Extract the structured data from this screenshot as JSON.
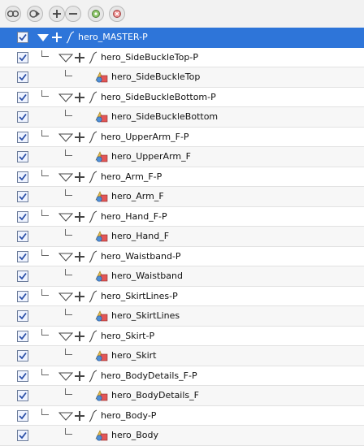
{
  "toolbar": {
    "buttons": [
      {
        "name": "show-all-icon"
      },
      {
        "name": "hide-all-icon"
      },
      {
        "name": "expand-icon"
      },
      {
        "name": "collapse-icon"
      },
      {
        "name": "layer-properties-icon"
      },
      {
        "name": "peg-icon"
      }
    ]
  },
  "layers": [
    {
      "label": "hero_MASTER-P",
      "type": "peg",
      "level": 0,
      "selected": true,
      "checked": true
    },
    {
      "label": "hero_SideBuckleTop-P",
      "type": "peg",
      "level": 1,
      "checked": true
    },
    {
      "label": "hero_SideBuckleTop",
      "type": "drawing",
      "level": 2,
      "checked": true
    },
    {
      "label": "hero_SideBuckleBottom-P",
      "type": "peg",
      "level": 1,
      "checked": true
    },
    {
      "label": "hero_SideBuckleBottom",
      "type": "drawing",
      "level": 2,
      "checked": true
    },
    {
      "label": "hero_UpperArm_F-P",
      "type": "peg",
      "level": 1,
      "checked": true
    },
    {
      "label": "hero_UpperArm_F",
      "type": "drawing",
      "level": 2,
      "checked": true
    },
    {
      "label": "hero_Arm_F-P",
      "type": "peg",
      "level": 1,
      "checked": true
    },
    {
      "label": "hero_Arm_F",
      "type": "drawing",
      "level": 2,
      "checked": true
    },
    {
      "label": "hero_Hand_F-P",
      "type": "peg",
      "level": 1,
      "checked": true
    },
    {
      "label": "hero_Hand_F",
      "type": "drawing",
      "level": 2,
      "checked": true
    },
    {
      "label": "hero_Waistband-P",
      "type": "peg",
      "level": 1,
      "checked": true
    },
    {
      "label": "hero_Waistband",
      "type": "drawing",
      "level": 2,
      "checked": true
    },
    {
      "label": "hero_SkirtLines-P",
      "type": "peg",
      "level": 1,
      "checked": true
    },
    {
      "label": "hero_SkirtLines",
      "type": "drawing",
      "level": 2,
      "checked": true
    },
    {
      "label": "hero_Skirt-P",
      "type": "peg",
      "level": 1,
      "checked": true
    },
    {
      "label": "hero_Skirt",
      "type": "drawing",
      "level": 2,
      "checked": true
    },
    {
      "label": "hero_BodyDetails_F-P",
      "type": "peg",
      "level": 1,
      "checked": true
    },
    {
      "label": "hero_BodyDetails_F",
      "type": "drawing",
      "level": 2,
      "checked": true
    },
    {
      "label": "hero_Body-P",
      "type": "peg",
      "level": 1,
      "checked": true
    },
    {
      "label": "hero_Body",
      "type": "drawing",
      "level": 2,
      "checked": true
    }
  ],
  "colors": {
    "selected_row": "#2e75d9",
    "check": "#2a4fa8"
  }
}
